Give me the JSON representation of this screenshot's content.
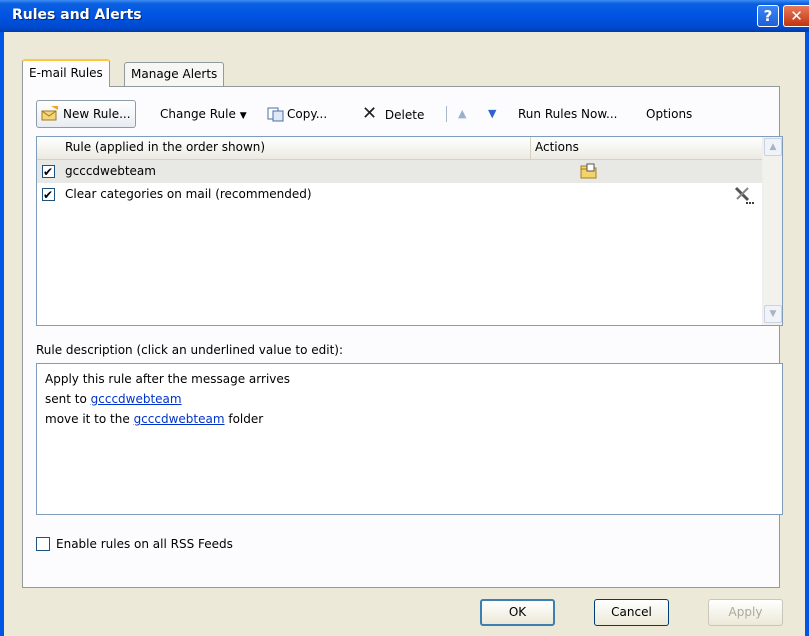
{
  "window": {
    "title": "Rules and Alerts"
  },
  "tabs": [
    {
      "label": "E-mail Rules",
      "active": true
    },
    {
      "label": "Manage Alerts",
      "active": false
    }
  ],
  "toolbar": {
    "new_rule": "New Rule...",
    "change_rule": "Change Rule",
    "copy": "Copy...",
    "delete": "Delete",
    "run_rules_now": "Run Rules Now...",
    "options": "Options"
  },
  "rules_list": {
    "columns": [
      "Rule (applied in the order shown)",
      "Actions"
    ],
    "rows": [
      {
        "name": "gcccdwebteam",
        "checked": true,
        "selected": true,
        "action_icon": "move-to-folder-icon"
      },
      {
        "name": "Clear categories on mail (recommended)",
        "checked": true,
        "selected": false,
        "action_icon": "tools-icon"
      }
    ]
  },
  "description": {
    "label": "Rule description (click an underlined value to edit):",
    "line1": "Apply this rule after the message arrives",
    "line2_prefix": "sent to ",
    "line2_link": "gcccdwebteam",
    "line3_prefix": "move it to the ",
    "line3_link": "gcccdwebteam",
    "line3_suffix": " folder"
  },
  "rss": {
    "label": "Enable rules on all RSS Feeds",
    "checked": false
  },
  "buttons": {
    "ok": "OK",
    "cancel": "Cancel",
    "apply": "Apply"
  },
  "colors": {
    "title_bar": "#0054e3",
    "tab_highlight": "#ffc83c",
    "link": "#0033cc"
  }
}
